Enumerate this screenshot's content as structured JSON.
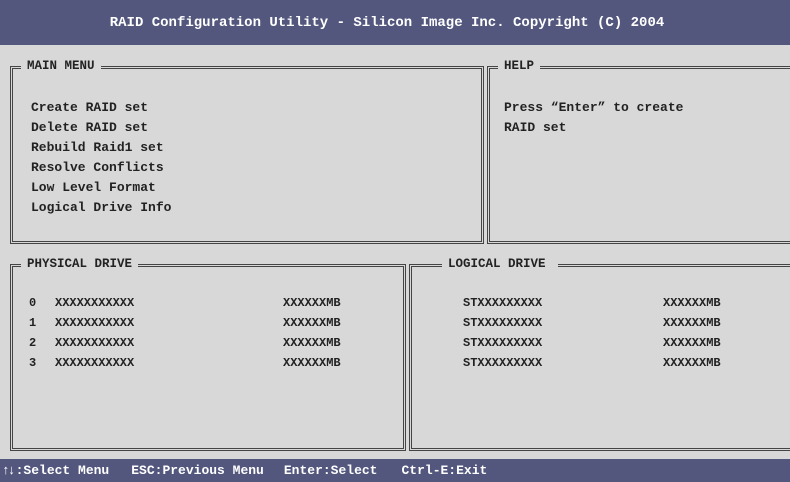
{
  "title": "RAID Configuration Utility - Silicon Image Inc. Copyright (C) 2004",
  "main_menu": {
    "label": "MAIN MENU",
    "items": [
      "Create RAID set",
      "Delete RAID set",
      "Rebuild Raid1 set",
      "Resolve Conflicts",
      "Low Level Format",
      "Logical Drive Info"
    ]
  },
  "help": {
    "label": "HELP",
    "text": "Press “Enter” to create\nRAID set"
  },
  "physical_drive": {
    "label": "PHYSICAL DRIVE",
    "rows": [
      {
        "index": "0",
        "name": "XXXXXXXXXXX",
        "size": "XXXXXXMB"
      },
      {
        "index": "1",
        "name": "XXXXXXXXXXX",
        "size": "XXXXXXMB"
      },
      {
        "index": "2",
        "name": "XXXXXXXXXXX",
        "size": "XXXXXXMB"
      },
      {
        "index": "3",
        "name": "XXXXXXXXXXX",
        "size": "XXXXXXMB"
      }
    ]
  },
  "logical_drive": {
    "label": "LOGICAL DRIVE",
    "rows": [
      {
        "name": "STXXXXXXXXX",
        "size": "XXXXXXMB"
      },
      {
        "name": "STXXXXXXXXX",
        "size": "XXXXXXMB"
      },
      {
        "name": "STXXXXXXXXX",
        "size": "XXXXXXMB"
      },
      {
        "name": "STXXXXXXXXX",
        "size": "XXXXXXMB"
      }
    ]
  },
  "status_bar": {
    "arrows": "↑↓",
    "select_menu": ":Select Menu",
    "previous_menu": "ESC:Previous Menu",
    "select": "Enter:Select",
    "exit": "Ctrl-E:Exit"
  },
  "colors": {
    "bar_background": "#53577e",
    "screen_background": "#d8d8d8",
    "text": "#222222"
  }
}
